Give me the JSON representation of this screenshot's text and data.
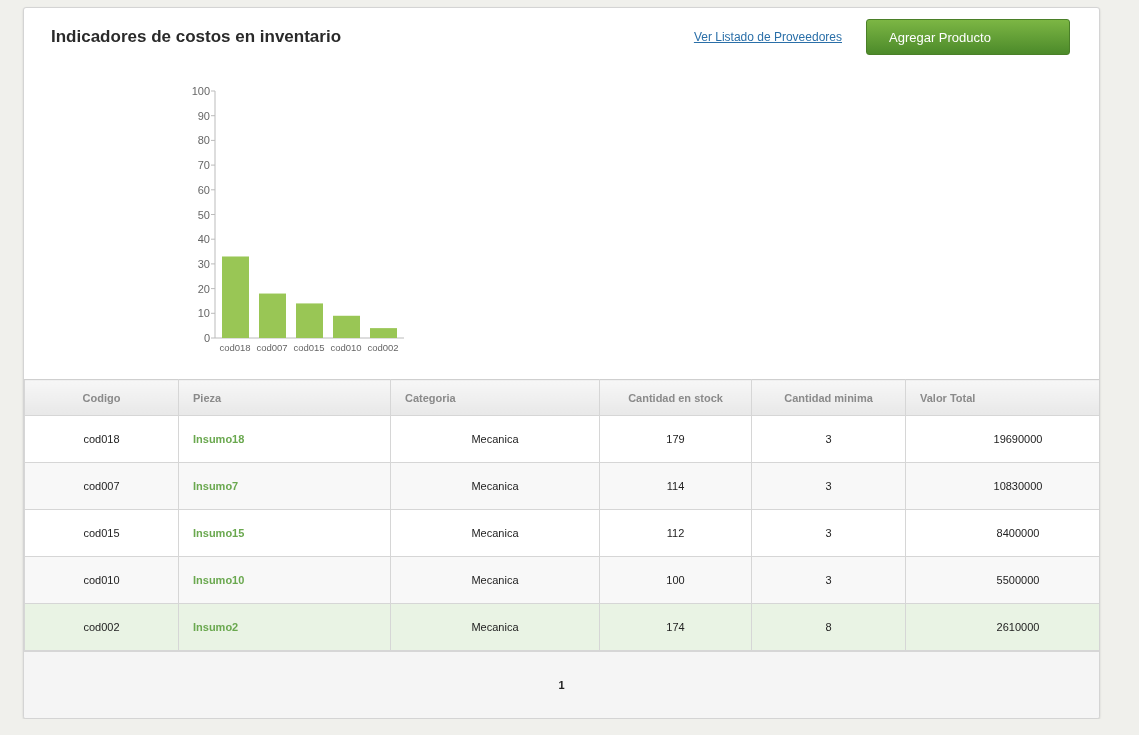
{
  "title": "Indicadores de costos en inventario",
  "suppliers_link": "Ver Listado de Proveedores",
  "add_button": "Agregar Producto",
  "chart_data": {
    "type": "bar",
    "categories": [
      "cod018",
      "cod007",
      "cod015",
      "cod010",
      "cod002"
    ],
    "series": [
      {
        "color": "#99c655",
        "values": [
          33,
          18,
          14,
          9,
          4
        ]
      }
    ],
    "ylim": [
      0,
      100
    ],
    "yticks": [
      0,
      10,
      20,
      30,
      40,
      50,
      60,
      70,
      80,
      90,
      100
    ]
  },
  "table": {
    "columns": [
      "Codigo",
      "Pieza",
      "Categoria",
      "Cantidad en stock",
      "Cantidad minima",
      "Valor Total"
    ],
    "rows": [
      {
        "codigo": "cod018",
        "pieza": "Insumo18",
        "categoria": "Mecanica",
        "stock": "179",
        "minima": "3",
        "valor": "19690000",
        "selected": false
      },
      {
        "codigo": "cod007",
        "pieza": "Insumo7",
        "categoria": "Mecanica",
        "stock": "114",
        "minima": "3",
        "valor": "10830000",
        "selected": false
      },
      {
        "codigo": "cod015",
        "pieza": "Insumo15",
        "categoria": "Mecanica",
        "stock": "112",
        "minima": "3",
        "valor": "8400000",
        "selected": false
      },
      {
        "codigo": "cod010",
        "pieza": "Insumo10",
        "categoria": "Mecanica",
        "stock": "100",
        "minima": "3",
        "valor": "5500000",
        "selected": false
      },
      {
        "codigo": "cod002",
        "pieza": "Insumo2",
        "categoria": "Mecanica",
        "stock": "174",
        "minima": "8",
        "valor": "2610000",
        "selected": true
      }
    ]
  },
  "pagination": [
    {
      "label": "1",
      "selected": true
    }
  ]
}
